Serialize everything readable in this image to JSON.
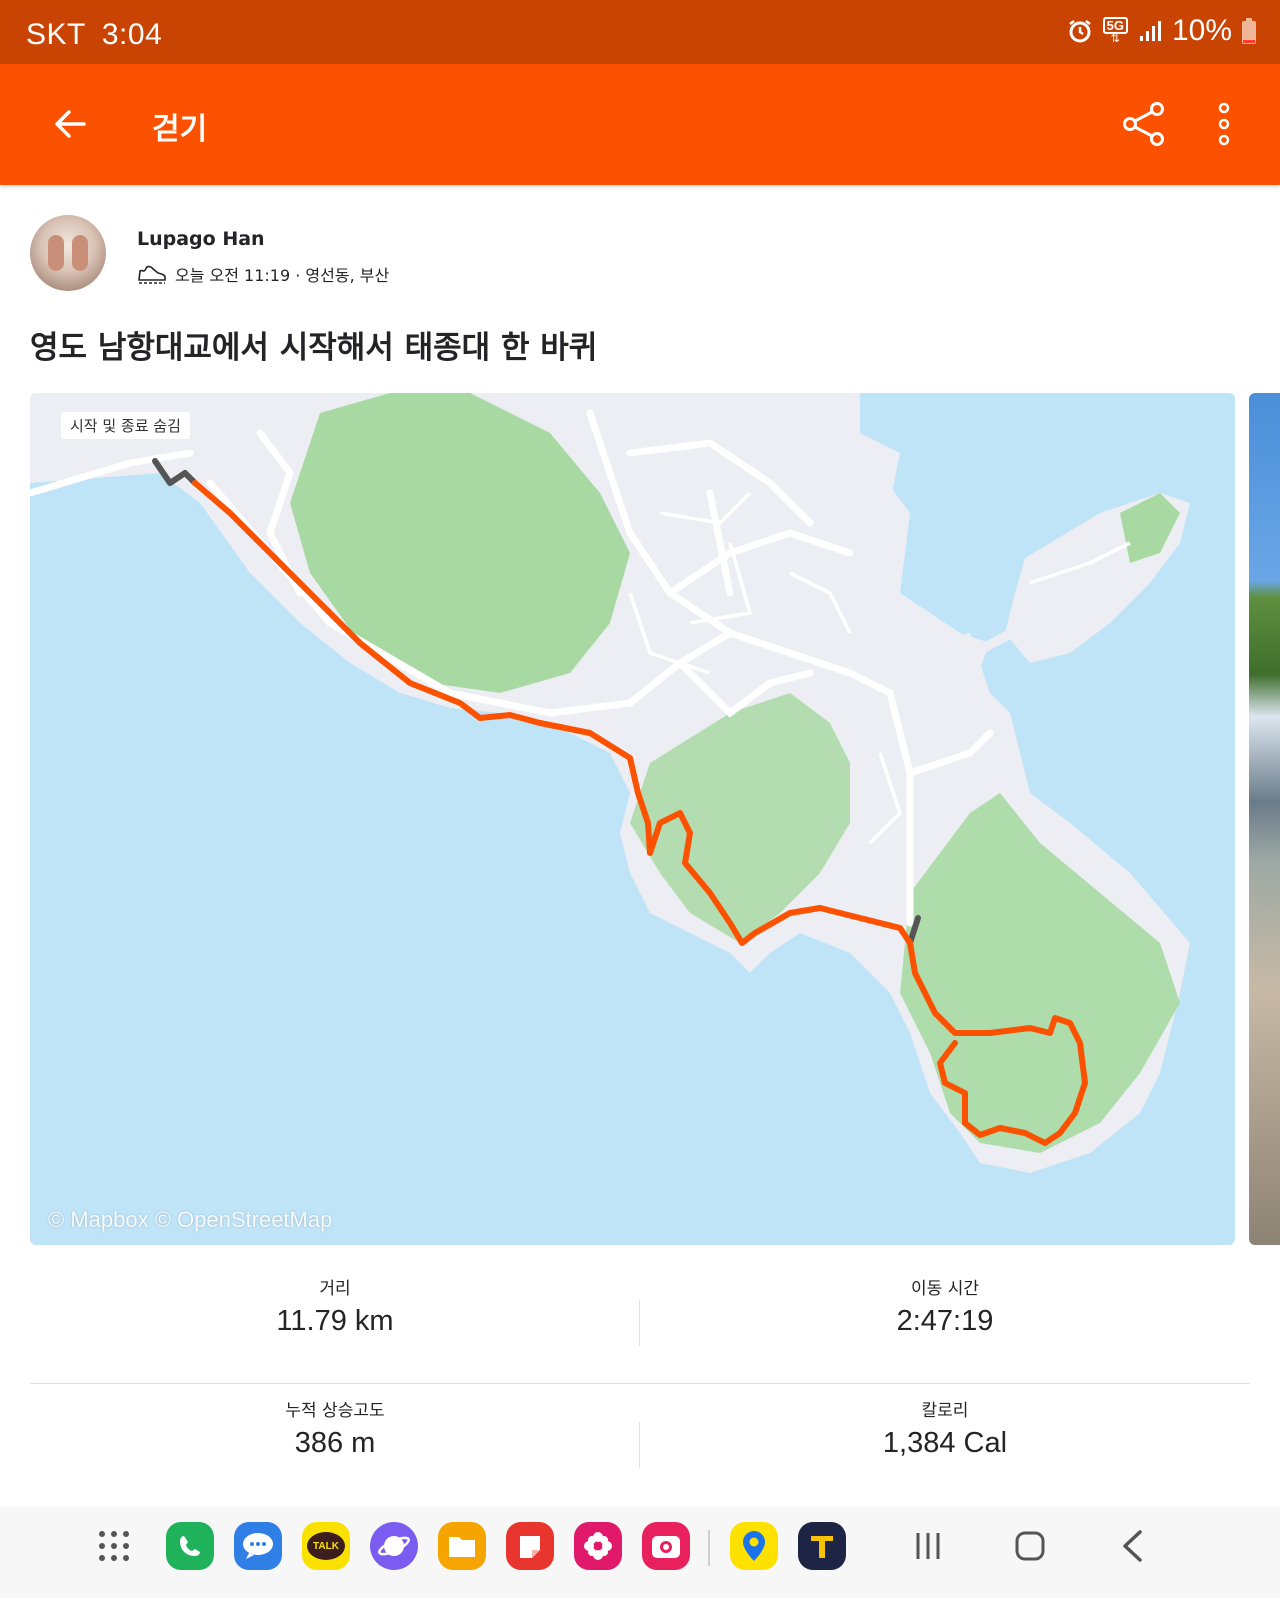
{
  "status_bar": {
    "carrier": "SKT",
    "time": "3:04",
    "network_badge": "5G",
    "battery": "10%",
    "icons": [
      "alarm-icon",
      "5g-icon",
      "signal-icon",
      "battery-icon"
    ]
  },
  "app_bar": {
    "title": "걷기",
    "icons": [
      "back-arrow-icon",
      "share-icon",
      "more-vert-icon"
    ]
  },
  "athlete": {
    "name": "Lupago Han",
    "meta": "오늘 오전 11:19 · 영선동, 부산",
    "activity_icon": "walking-shoe-icon"
  },
  "activity": {
    "title": "영도 남항대교에서 시작해서 태종대 한 바퀴"
  },
  "map": {
    "hide_start_end_label": "시작 및 종료 숨김",
    "attribution": "© Mapbox © OpenStreetMap",
    "colors": {
      "water": "#bfe3f7",
      "land": "#eceef3",
      "park": "#a9d9a3",
      "route": "#fc5200",
      "hidden_route": "#555555"
    }
  },
  "stats": [
    {
      "label": "거리",
      "value": "11.79 km"
    },
    {
      "label": "이동 시간",
      "value": "2:47:19"
    },
    {
      "label": "누적 상승고도",
      "value": "386 m"
    },
    {
      "label": "칼로리",
      "value": "1,384 Cal"
    }
  ],
  "nav_bar": {
    "dock_apps": [
      {
        "icon": "app-drawer-icon"
      },
      {
        "icon": "phone-app-icon",
        "color": "#1fb25a"
      },
      {
        "icon": "messages-app-icon",
        "color": "#2f7fe6"
      },
      {
        "icon": "kakaotalk-app-icon",
        "color": "#fae100",
        "label": "TALK"
      },
      {
        "icon": "internet-app-icon",
        "color": "#7a5cf0"
      },
      {
        "icon": "my-files-app-icon",
        "color": "#f5a400"
      },
      {
        "icon": "notes-app-icon",
        "color": "#e8362f"
      },
      {
        "icon": "flower-app-icon",
        "color": "#e0196b"
      },
      {
        "icon": "camera-app-icon",
        "color": "#e8215e"
      },
      {
        "icon": "map-app-icon",
        "color": "#ffe100"
      },
      {
        "icon": "t-map-app-icon",
        "color": "#1d2444"
      }
    ],
    "system": [
      "recents-icon",
      "home-icon",
      "back-icon"
    ]
  }
}
